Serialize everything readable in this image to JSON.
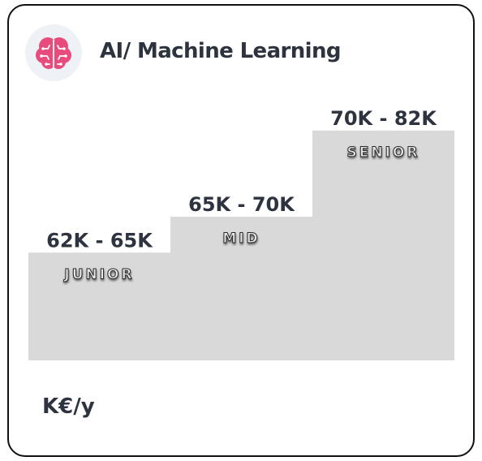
{
  "header": {
    "title": "AI/ Machine Learning",
    "icon": "brain-circuit-icon",
    "icon_color": "#e84c7d"
  },
  "unit_label": "K€/y",
  "colors": {
    "step_fill": "#d9d9d9",
    "text": "#2d3440",
    "level_fill": "#6b6b6b"
  },
  "chart_data": {
    "type": "bar",
    "title": "AI/ Machine Learning",
    "ylabel": "K€/y",
    "categories": [
      "JUNIOR",
      "MID",
      "SENIOR"
    ],
    "series": [
      {
        "values": [
          62,
          65,
          70
        ]
      },
      {
        "values": [
          65,
          70,
          82
        ]
      }
    ],
    "range_labels": [
      "62K - 65K",
      "65K - 70K",
      "70K - 82K"
    ],
    "grid": false
  }
}
